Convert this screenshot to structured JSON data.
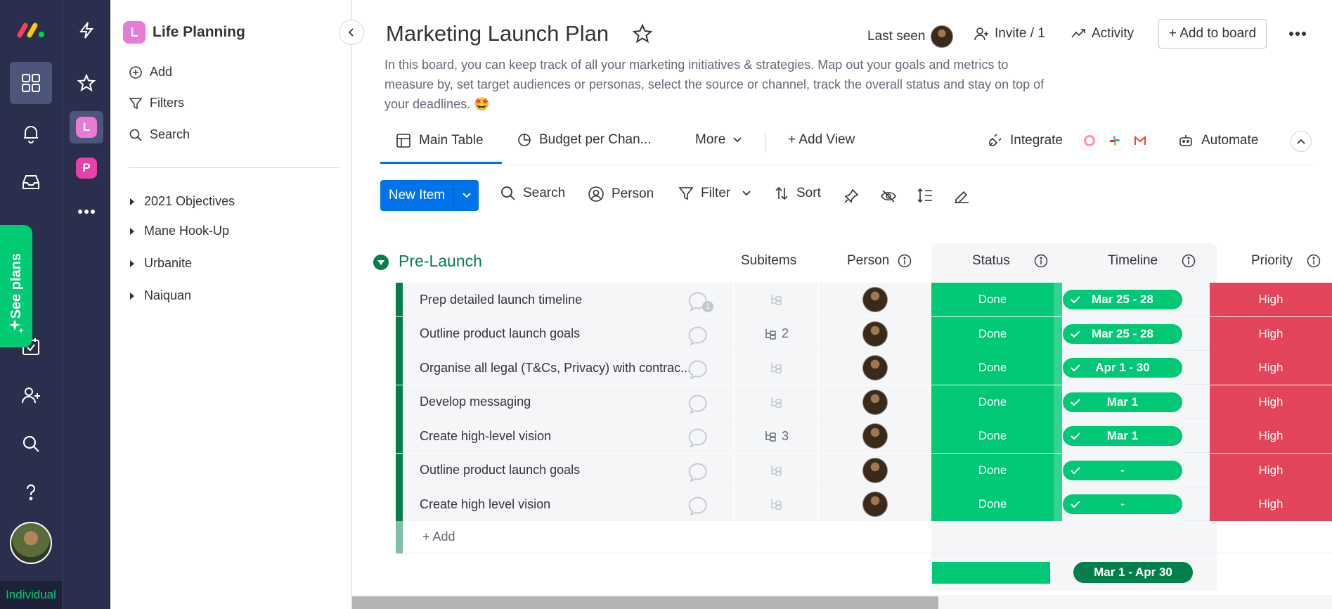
{
  "rail": {
    "individual_label": "Individual",
    "see_plans_label": "See plans"
  },
  "workspace": {
    "badge_letter": "L",
    "second_badge_letter": "P",
    "name": "Life Planning",
    "add_label": "Add",
    "filters_label": "Filters",
    "search_label": "Search",
    "boards": [
      "2021 Objectives",
      "Mane Hook-Up",
      "Urbanite",
      "Naiquan"
    ]
  },
  "header": {
    "title": "Marketing Launch Plan",
    "last_seen_label": "Last seen",
    "invite_label": "Invite / 1",
    "activity_label": "Activity",
    "add_to_board_label": "+ Add to board",
    "description": "In this board, you can keep track of all your marketing initiatives & strategies. Map out your goals and metrics to measure by, set target audiences or personas, select the source or channel, track the overall status and stay on top of your deadlines. 🤩"
  },
  "tabs": {
    "main_table": "Main Table",
    "budget": "Budget per Chan...",
    "more": "More",
    "add_view": "+ Add View",
    "integrate": "Integrate",
    "automate": "Automate"
  },
  "toolbar": {
    "new_item": "New Item",
    "search": "Search",
    "person": "Person",
    "filter": "Filter",
    "sort": "Sort"
  },
  "group": {
    "title": "Pre-Launch",
    "color": "#037f4c",
    "columns": {
      "subitems": "Subitems",
      "person": "Person",
      "status": "Status",
      "timeline": "Timeline",
      "priority": "Priority"
    },
    "rows": [
      {
        "name": "Prep detailed launch timeline",
        "subitems": "",
        "updates": "1",
        "status": "Done",
        "timeline": "Mar 25 - 28",
        "priority": "High"
      },
      {
        "name": "Outline product launch goals",
        "subitems": "2",
        "updates": "",
        "status": "Done",
        "timeline": "Mar 25 - 28",
        "priority": "High"
      },
      {
        "name": "Organise all legal (T&Cs, Privacy) with contrac...",
        "subitems": "",
        "updates": "",
        "status": "Done",
        "timeline": "Apr 1 - 30",
        "priority": "High"
      },
      {
        "name": "Develop messaging",
        "subitems": "",
        "updates": "",
        "status": "Done",
        "timeline": "Mar 1",
        "priority": "High"
      },
      {
        "name": "Create high-level vision",
        "subitems": "3",
        "updates": "",
        "status": "Done",
        "timeline": "Mar 1",
        "priority": "High"
      },
      {
        "name": "Outline product launch goals",
        "subitems": "",
        "updates": "",
        "status": "Done",
        "timeline": "-",
        "priority": "High"
      },
      {
        "name": "Create high level vision",
        "subitems": "",
        "updates": "",
        "status": "Done",
        "timeline": "-",
        "priority": "High"
      }
    ],
    "add_item_label": "+ Add",
    "summary_timeline": "Mar 1 - Apr 30"
  },
  "colors": {
    "done": "#00c875",
    "high": "#e2445c",
    "primary": "#0073ea",
    "rail": "#292f4c"
  }
}
